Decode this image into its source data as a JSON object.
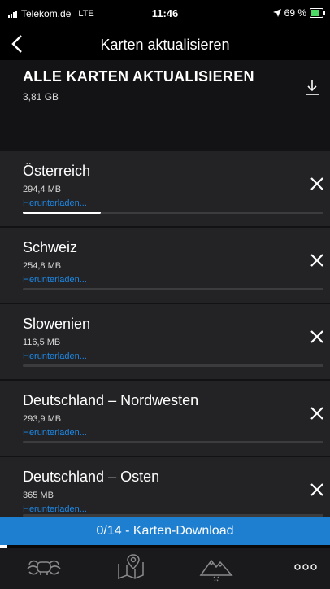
{
  "status_bar": {
    "carrier": "Telekom.de",
    "network": "LTE",
    "time": "11:46",
    "battery": "69 %"
  },
  "nav": {
    "title": "Karten aktualisieren"
  },
  "update_all": {
    "title": "ALLE KARTEN AKTUALISIEREN",
    "size": "3,81 GB"
  },
  "maps": [
    {
      "name": "Österreich",
      "size": "294,4 MB",
      "status": "Herunterladen...",
      "progress": 0.26
    },
    {
      "name": "Schweiz",
      "size": "254,8 MB",
      "status": "Herunterladen...",
      "progress": 0
    },
    {
      "name": "Slowenien",
      "size": "116,5 MB",
      "status": "Herunterladen...",
      "progress": 0
    },
    {
      "name": "Deutschland – Nordwesten",
      "size": "293,9 MB",
      "status": "Herunterladen...",
      "progress": 0
    },
    {
      "name": "Deutschland – Osten",
      "size": "365 MB",
      "status": "Herunterladen...",
      "progress": 0
    }
  ],
  "banner": {
    "text": "0/14 - Karten-Download",
    "progress": 0.02
  },
  "tabs": [
    {
      "icon": "motorcycle-icon"
    },
    {
      "icon": "map-pin-icon"
    },
    {
      "icon": "mountain-route-icon"
    },
    {
      "icon": "more-dots-icon"
    }
  ],
  "colors": {
    "accent": "#1e88e5",
    "banner": "#1e7fd0",
    "background": "#1b1b1d",
    "row": "#232325"
  }
}
